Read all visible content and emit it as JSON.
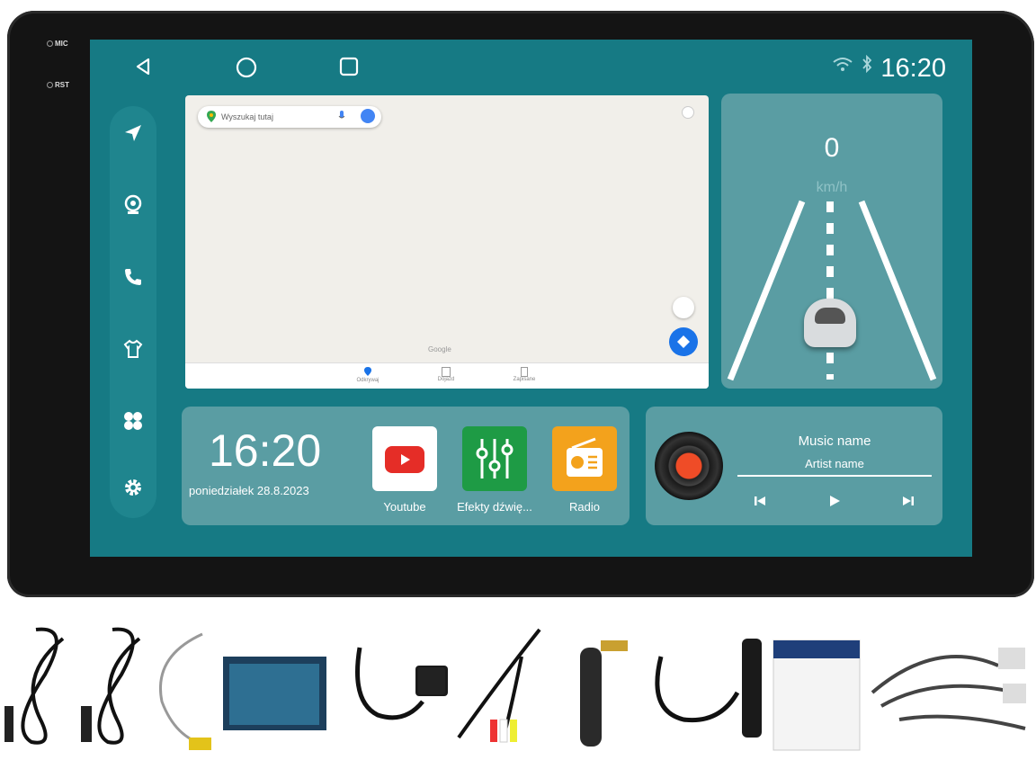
{
  "hardware": {
    "mic_label": "MIC",
    "rst_label": "RST"
  },
  "statusbar": {
    "time": "16:20",
    "icons": [
      "wifi-icon",
      "bluetooth-icon"
    ]
  },
  "navbar": {
    "icons": [
      "back-icon",
      "home-icon",
      "recents-icon"
    ]
  },
  "sidebar": {
    "items": [
      "navigation-icon",
      "camera-icon",
      "phone-icon",
      "shirt-icon",
      "apps-icon",
      "settings-icon"
    ]
  },
  "map": {
    "search_placeholder": "Wyszukaj tutaj",
    "brand": "Google",
    "tabs": [
      "Odkrywaj",
      "Dojazd",
      "Zapisane"
    ]
  },
  "speed": {
    "value": "0",
    "unit": "km/h"
  },
  "clock": {
    "time": "16:20",
    "date": "poniedziałek 28.8.2023"
  },
  "apps": [
    {
      "label": "Youtube",
      "color": "#ffffff",
      "icon": "youtube-icon"
    },
    {
      "label": "Efekty dźwię...",
      "color": "#1e9b45",
      "icon": "equalizer-icon"
    },
    {
      "label": "Radio",
      "color": "#f3a21c",
      "icon": "radio-icon"
    }
  ],
  "music": {
    "title": "Music name",
    "artist": "Artist name"
  },
  "colors": {
    "screen": "#167a84",
    "widget": "#5a9da3",
    "bezel": "#141414",
    "youtube_red": "#e52d27"
  },
  "accessories": [
    "cable-1",
    "cable-2",
    "camera-cable",
    "box",
    "power-cable",
    "gps-antenna",
    "rca-cable",
    "4g-antenna",
    "usb-cable",
    "dab-antenna",
    "manual",
    "wiring-harness"
  ]
}
